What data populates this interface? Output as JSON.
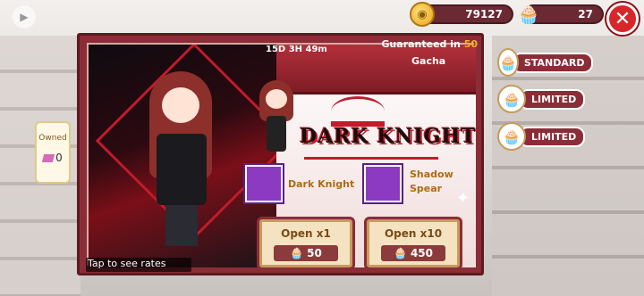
{
  "currency": {
    "coins": "79127",
    "cakes": "27"
  },
  "banner": {
    "timer": "15D 3H 49m",
    "guarantee_prefix": "Guaranteed in ",
    "guarantee_count": "50",
    "guarantee_suffix": "Gacha",
    "owned_label": "Owned",
    "owned_value": "0",
    "rates_link": "Tap to see rates",
    "logo_text": "DARK KNIGHT",
    "items": [
      {
        "name": "Dark Knight"
      },
      {
        "name": "Shadow Spear"
      }
    ]
  },
  "actions": {
    "open1": {
      "label": "Open x1",
      "price": "50"
    },
    "open10": {
      "label": "Open x10",
      "price": "450"
    }
  },
  "side_tabs": [
    "STANDARD",
    "LIMITED",
    "LIMITED"
  ],
  "icons": {
    "coin": "coin-icon",
    "cake": "cupcake-icon",
    "close": "close-icon",
    "play": "play-store-icon",
    "gem": "pink-gem-icon"
  }
}
